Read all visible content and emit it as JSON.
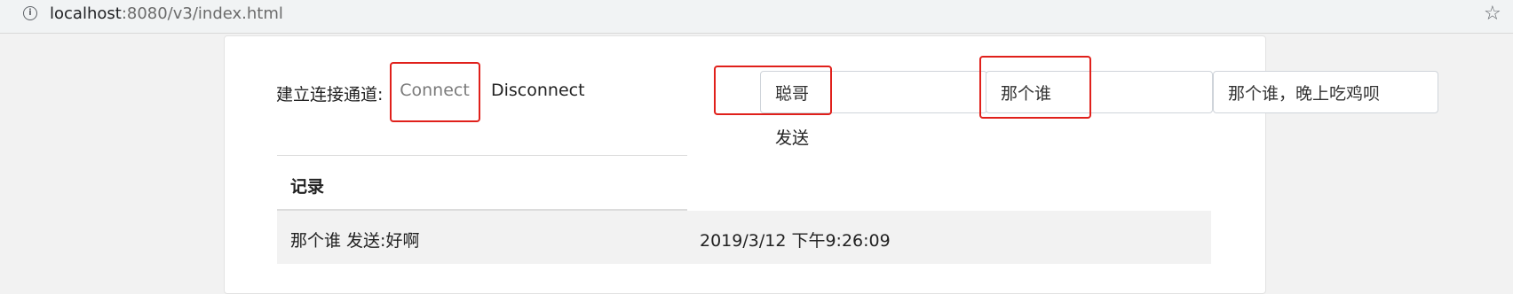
{
  "browser": {
    "url_host": "localhost",
    "url_rest": ":8080/v3/index.html"
  },
  "form": {
    "channel_label": "建立连接通道:",
    "connect_label": "Connect",
    "disconnect_label": "Disconnect",
    "name_value": "聪哥",
    "to_value": "那个谁",
    "message_value": "那个谁，晚上吃鸡呗",
    "send_label": "发送"
  },
  "table": {
    "header": "记录",
    "rows": [
      {
        "message": "那个谁 发送:好啊",
        "time": "2019/3/12 下午9:26:09"
      }
    ]
  },
  "colors": {
    "highlight_box": "#e0201b"
  }
}
